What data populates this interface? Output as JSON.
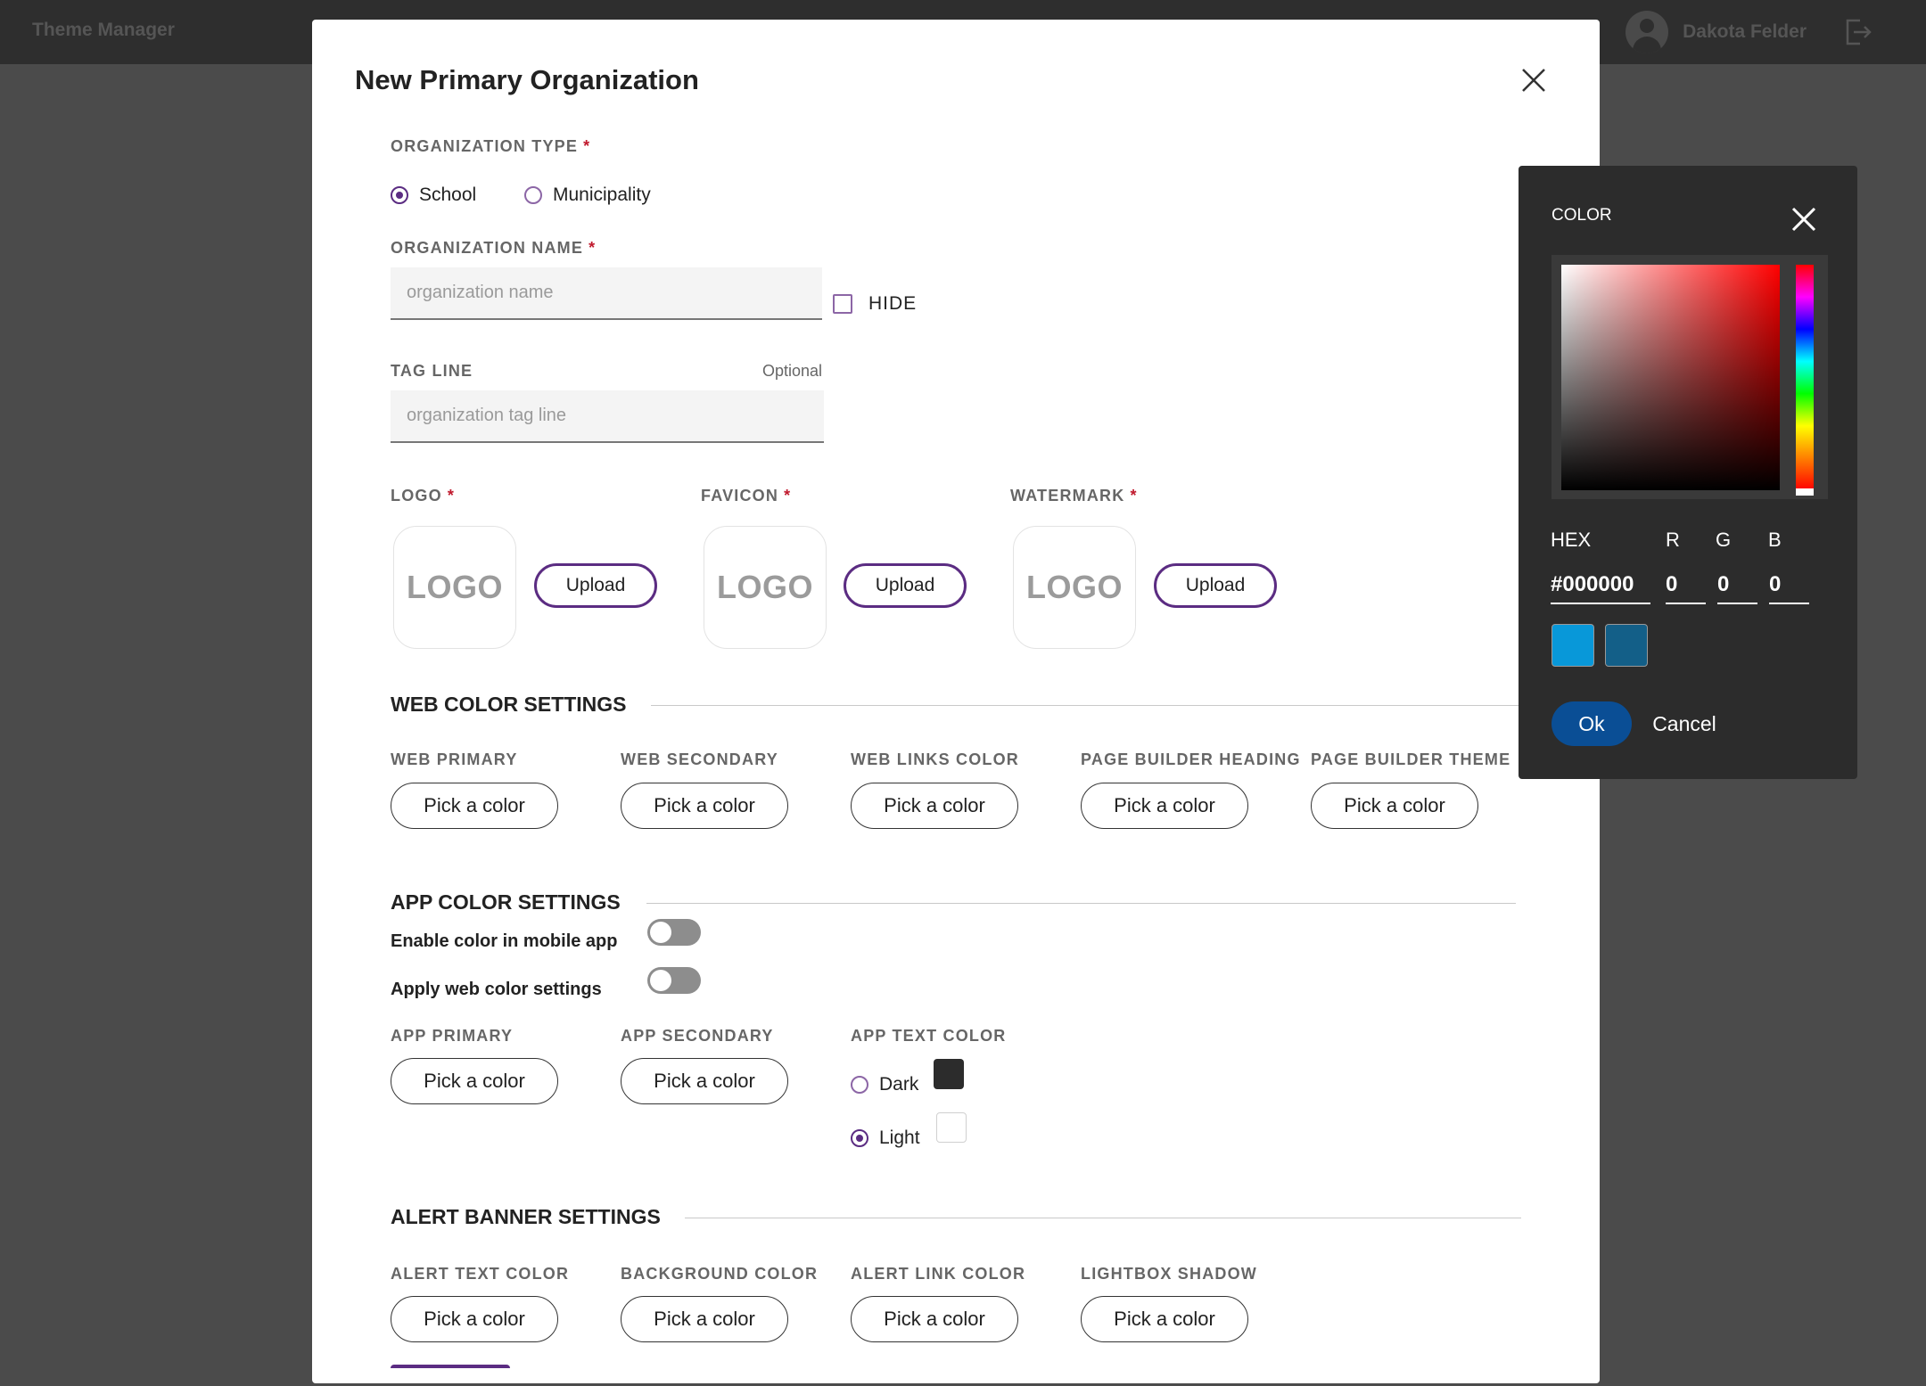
{
  "app": {
    "title": "Theme Manager"
  },
  "user": {
    "name": "Dakota Felder"
  },
  "modal": {
    "title": "New Primary Organization",
    "required_mark": "*",
    "org_type": {
      "label": "ORGANIZATION TYPE",
      "options": [
        {
          "label": "School",
          "selected": true
        },
        {
          "label": "Municipality",
          "selected": false
        }
      ]
    },
    "org_name": {
      "label": "ORGANIZATION NAME",
      "value": "",
      "placeholder": "organization name",
      "hide_label": "HIDE",
      "hide_checked": false
    },
    "tag_line": {
      "label": "TAG LINE",
      "optional": "Optional",
      "value": "",
      "placeholder": "organization tag line"
    },
    "assets": [
      {
        "label": "LOGO",
        "preview": "LOGO",
        "button": "Upload"
      },
      {
        "label": "FAVICON",
        "preview": "LOGO",
        "button": "Upload"
      },
      {
        "label": "WATERMARK",
        "preview": "LOGO",
        "button": "Upload"
      }
    ],
    "web_colors": {
      "title": "WEB COLOR SETTINGS",
      "fields": [
        {
          "label": "WEB PRIMARY",
          "button": "Pick a color"
        },
        {
          "label": "WEB SECONDARY",
          "button": "Pick a color"
        },
        {
          "label": "WEB LINKS COLOR",
          "button": "Pick a color"
        },
        {
          "label": "PAGE BUILDER HEADING",
          "button": "Pick a color"
        },
        {
          "label": "PAGE BUILDER THEME",
          "button": "Pick a color"
        }
      ]
    },
    "app_colors": {
      "title": "APP COLOR SETTINGS",
      "toggles": [
        {
          "label": "Enable color in mobile app",
          "on": false
        },
        {
          "label": "Apply web color settings",
          "on": false
        }
      ],
      "fields": [
        {
          "label": "APP PRIMARY",
          "button": "Pick a color"
        },
        {
          "label": "APP SECONDARY",
          "button": "Pick a color"
        }
      ],
      "text_color": {
        "label": "APP TEXT COLOR",
        "options": [
          {
            "label": "Dark",
            "selected": false,
            "swatch": "#2c2c2c"
          },
          {
            "label": "Light",
            "selected": true,
            "swatch": "#ffffff"
          }
        ]
      }
    },
    "alert_banner": {
      "title": "ALERT BANNER SETTINGS",
      "fields": [
        {
          "label": "ALERT TEXT COLOR",
          "button": "Pick a color"
        },
        {
          "label": "BACKGROUND COLOR",
          "button": "Pick a color"
        },
        {
          "label": "ALERT LINK COLOR",
          "button": "Pick a color"
        },
        {
          "label": "LIGHTBOX SHADOW",
          "button": "Pick a color"
        }
      ]
    }
  },
  "color_picker": {
    "title": "COLOR",
    "hex_label": "HEX",
    "r_label": "R",
    "g_label": "G",
    "b_label": "B",
    "hex": "#000000",
    "r": "0",
    "g": "0",
    "b": "0",
    "recent": [
      "#0898d9",
      "#135f88"
    ],
    "ok": "Ok",
    "cancel": "Cancel"
  },
  "colors": {
    "accent": "#5b2c82",
    "required": "#c0192d",
    "ok_button": "#0a4e95",
    "overlay": "#4b4b4b",
    "topbar": "#2e2e2e",
    "picker_bg": "#2c2c2c"
  }
}
